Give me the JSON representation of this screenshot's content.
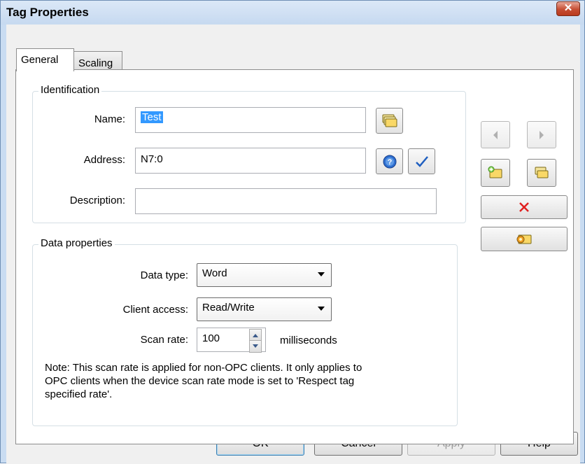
{
  "window": {
    "title": "Tag Properties",
    "close_glyph": "✕"
  },
  "tabs": [
    {
      "label": "General",
      "active": true
    },
    {
      "label": "Scaling",
      "active": false
    }
  ],
  "identification": {
    "title": "Identification",
    "name_label": "Name:",
    "name_value": "Test",
    "address_label": "Address:",
    "address_value": "N7:0",
    "description_label": "Description:",
    "description_value": ""
  },
  "data_properties": {
    "title": "Data properties",
    "data_type_label": "Data type:",
    "data_type_value": "Word",
    "client_access_label": "Client access:",
    "client_access_value": "Read/Write",
    "scan_rate_label": "Scan rate:",
    "scan_rate_value": "100",
    "scan_rate_unit": "milliseconds",
    "note_line1": "Note: This scan rate is applied for non-OPC clients. It only applies to",
    "note_line2": "OPC clients when the device scan rate mode is set to 'Respect tag",
    "note_line3": "specified rate'."
  },
  "footer": {
    "ok_label": "OK",
    "cancel_label": "Cancel",
    "apply_label": "Apply",
    "help_label": "Help"
  },
  "icons": {
    "browse": "tag-browse-icon",
    "help": "help-circle-icon",
    "check": "checkmark-icon",
    "prev": "arrow-left-icon",
    "next": "arrow-right-icon",
    "new_tag": "new-tag-icon",
    "duplicate_tag": "duplicate-tag-icon",
    "delete": "delete-x-icon",
    "auto_generate": "auto-generate-tag-icon"
  },
  "colors": {
    "title_bar": "#c6d9f0",
    "close_red": "#c64e33",
    "selection_blue": "#3399ff",
    "delete_red": "#e02020",
    "check_blue": "#1f5fc0"
  }
}
